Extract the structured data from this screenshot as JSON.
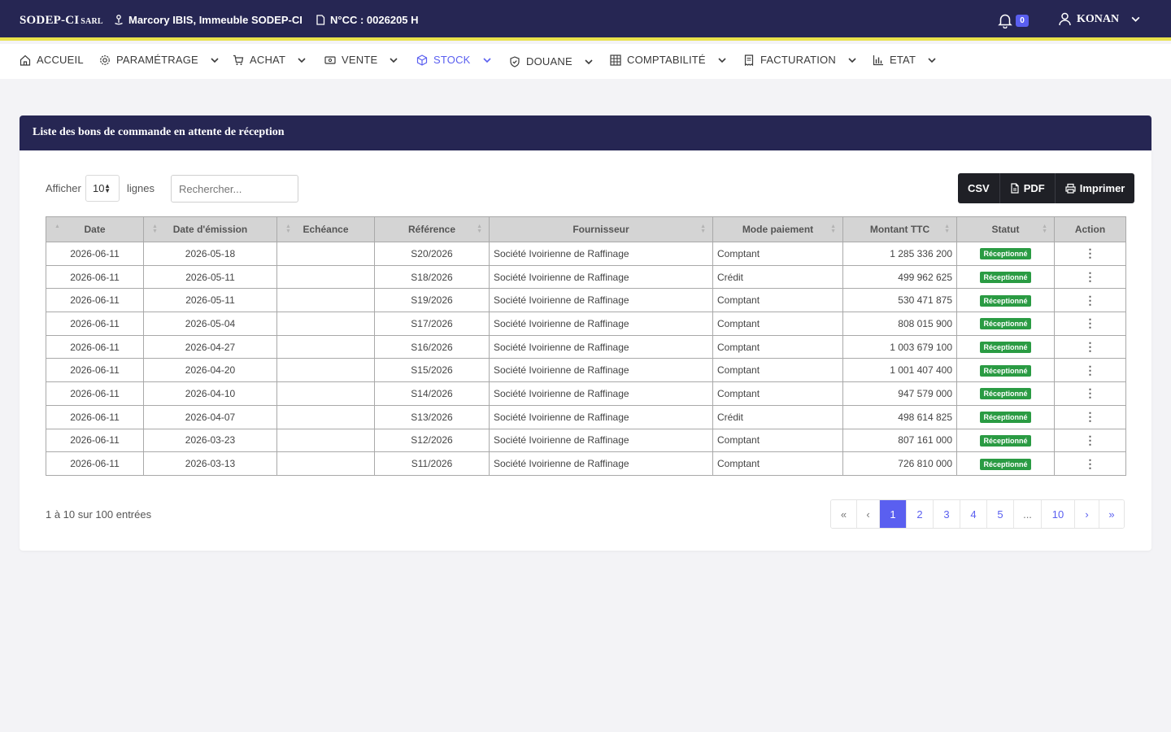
{
  "topbar": {
    "brand": "SODEP-CI",
    "brand_suffix": "SARL",
    "address": "Marcory IBIS, Immeuble SODEP-CI",
    "cc_number": "N°CC : 0026205 H",
    "notifications": "0",
    "username": "KONAN"
  },
  "nav": [
    {
      "label": "ACCUEIL",
      "icon": "home-icon",
      "dropdown": false
    },
    {
      "label": "PARAMÉTRAGE",
      "icon": "gear-icon",
      "dropdown": true
    },
    {
      "label": "ACHAT",
      "icon": "cart-icon",
      "dropdown": true
    },
    {
      "label": "VENTE",
      "icon": "cash-icon",
      "dropdown": true
    },
    {
      "label": "STOCK",
      "icon": "box-icon",
      "dropdown": true,
      "active": true
    },
    {
      "label": "DOUANE",
      "icon": "shield-icon",
      "dropdown": true
    },
    {
      "label": "COMPTABILITÉ",
      "icon": "grid-icon",
      "dropdown": true
    },
    {
      "label": "FACTURATION",
      "icon": "receipt-icon",
      "dropdown": true
    },
    {
      "label": "ETAT",
      "icon": "bar-chart-icon",
      "dropdown": true
    }
  ],
  "card": {
    "title": "Liste des bons de commande en attente de réception",
    "show_label": "Afficher",
    "page_length": "10",
    "lines_label": "lignes",
    "search_placeholder": "Rechercher...",
    "export": {
      "csv": "CSV",
      "pdf": "PDF",
      "print": "Imprimer"
    }
  },
  "table": {
    "columns": [
      "Date",
      "Date d'émission",
      "Echéance",
      "Référence",
      "Fournisseur",
      "Mode paiement",
      "Montant TTC",
      "Statut",
      "Action"
    ],
    "rows": [
      {
        "date": "2026-06-11",
        "emission": "2026-05-18",
        "echeance": "",
        "reference": "S20/2026",
        "fournisseur": "Société Ivoirienne de Raffinage",
        "mode": "Comptant",
        "montant": "1 285 336 200",
        "statut": "Réceptionné"
      },
      {
        "date": "2026-06-11",
        "emission": "2026-05-11",
        "echeance": "",
        "reference": "S18/2026",
        "fournisseur": "Société Ivoirienne de Raffinage",
        "mode": "Crédit",
        "montant": "499 962 625",
        "statut": "Réceptionné"
      },
      {
        "date": "2026-06-11",
        "emission": "2026-05-11",
        "echeance": "",
        "reference": "S19/2026",
        "fournisseur": "Société Ivoirienne de Raffinage",
        "mode": "Comptant",
        "montant": "530 471 875",
        "statut": "Réceptionné"
      },
      {
        "date": "2026-06-11",
        "emission": "2026-05-04",
        "echeance": "",
        "reference": "S17/2026",
        "fournisseur": "Société Ivoirienne de Raffinage",
        "mode": "Comptant",
        "montant": "808 015 900",
        "statut": "Réceptionné"
      },
      {
        "date": "2026-06-11",
        "emission": "2026-04-27",
        "echeance": "",
        "reference": "S16/2026",
        "fournisseur": "Société Ivoirienne de Raffinage",
        "mode": "Comptant",
        "montant": "1 003 679 100",
        "statut": "Réceptionné"
      },
      {
        "date": "2026-06-11",
        "emission": "2026-04-20",
        "echeance": "",
        "reference": "S15/2026",
        "fournisseur": "Société Ivoirienne de Raffinage",
        "mode": "Comptant",
        "montant": "1 001 407 400",
        "statut": "Réceptionné"
      },
      {
        "date": "2026-06-11",
        "emission": "2026-04-10",
        "echeance": "",
        "reference": "S14/2026",
        "fournisseur": "Société Ivoirienne de Raffinage",
        "mode": "Comptant",
        "montant": "947 579 000",
        "statut": "Réceptionné"
      },
      {
        "date": "2026-06-11",
        "emission": "2026-04-07",
        "echeance": "",
        "reference": "S13/2026",
        "fournisseur": "Société Ivoirienne de Raffinage",
        "mode": "Crédit",
        "montant": "498 614 825",
        "statut": "Réceptionné"
      },
      {
        "date": "2026-06-11",
        "emission": "2026-03-23",
        "echeance": "",
        "reference": "S12/2026",
        "fournisseur": "Société Ivoirienne de Raffinage",
        "mode": "Comptant",
        "montant": "807 161 000",
        "statut": "Réceptionné"
      },
      {
        "date": "2026-06-11",
        "emission": "2026-03-13",
        "echeance": "",
        "reference": "S11/2026",
        "fournisseur": "Société Ivoirienne de Raffinage",
        "mode": "Comptant",
        "montant": "726 810 000",
        "statut": "Réceptionné"
      }
    ],
    "action_glyph": "⋮"
  },
  "footer": {
    "info": "1 à 10 sur 100 entrées",
    "pages": [
      "«",
      "‹",
      "1",
      "2",
      "3",
      "4",
      "5",
      "...",
      "10",
      "›",
      "»"
    ],
    "current_page": "1"
  },
  "colors": {
    "brand_navy": "#262653",
    "accent_yellow": "#e9e24a",
    "accent_blue": "#5a5ff0",
    "status_green": "#2a9b43"
  }
}
